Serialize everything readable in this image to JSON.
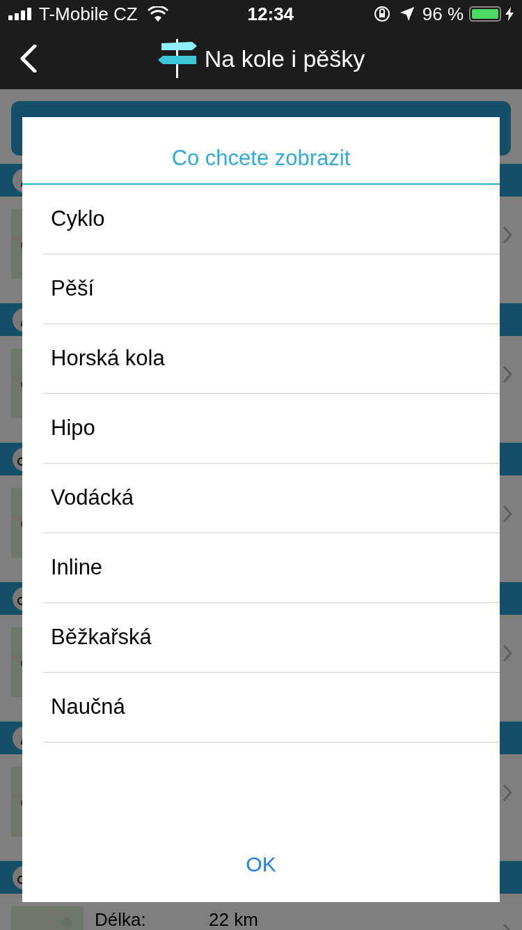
{
  "status_bar": {
    "carrier": "T-Mobile CZ",
    "time": "12:34",
    "battery": "96 %"
  },
  "nav": {
    "title": "Na kole i pěšky"
  },
  "routes": [
    {
      "kind": "hiking"
    },
    {
      "kind": "hiking"
    },
    {
      "kind": "cycling"
    },
    {
      "kind": "cycling"
    },
    {
      "kind": "hiking"
    },
    {
      "kind": "cycling",
      "length_label": "Délka:",
      "length_value": "22 km"
    }
  ],
  "dialog": {
    "title": "Co chcete zobrazit",
    "options": [
      "Cyklo",
      "Pěší",
      "Horská kola",
      "Hipo",
      "Vodácká",
      "Inline",
      "Běžkařská",
      "Naučná"
    ],
    "ok": "OK"
  }
}
